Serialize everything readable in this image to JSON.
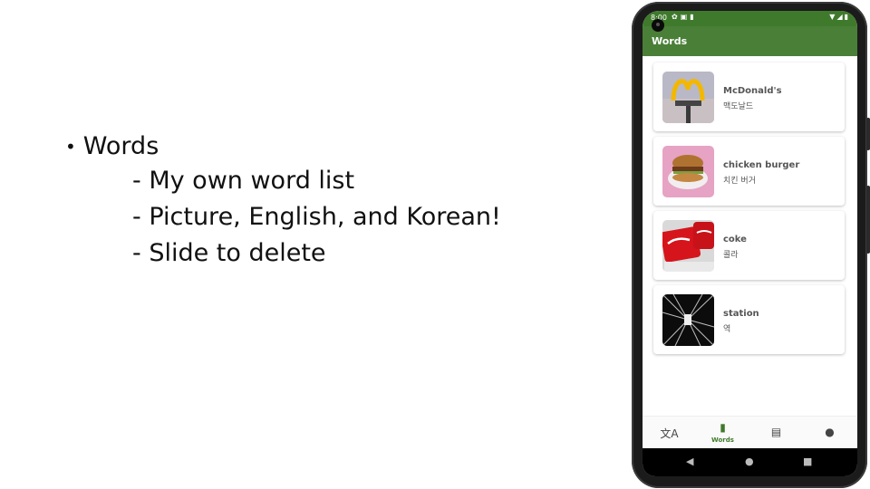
{
  "slide": {
    "bullet": "Words",
    "subpoints": [
      "- My own word list",
      "- Picture, English, and Korean!",
      "- Slide to delete"
    ]
  },
  "status_bar": {
    "time": "8:00",
    "left_icons": [
      "gear-icon",
      "mail-icon",
      "sd-card-icon"
    ],
    "right_icons": [
      "wifi-icon",
      "signal-icon",
      "battery-icon"
    ]
  },
  "app_bar": {
    "title": "Words"
  },
  "words": [
    {
      "english": "McDonald's",
      "korean": "맥도날드",
      "image": "mcdonalds-sign-image"
    },
    {
      "english": "chicken burger",
      "korean": "치킨 버거",
      "image": "chicken-burger-image"
    },
    {
      "english": "coke",
      "korean": "콜라",
      "image": "coke-cans-image"
    },
    {
      "english": "station",
      "korean": "역",
      "image": "station-image"
    }
  ],
  "bottom_nav": {
    "items": [
      {
        "icon": "translate-icon",
        "label": ""
      },
      {
        "icon": "book-icon",
        "label": "Words"
      },
      {
        "icon": "chat-icon",
        "label": ""
      },
      {
        "icon": "person-icon",
        "label": ""
      }
    ],
    "active_index": 1
  },
  "colors": {
    "app_bar": "#4a7f38",
    "status_bar": "#3f7a2c",
    "active_nav": "#3f7a2c"
  }
}
